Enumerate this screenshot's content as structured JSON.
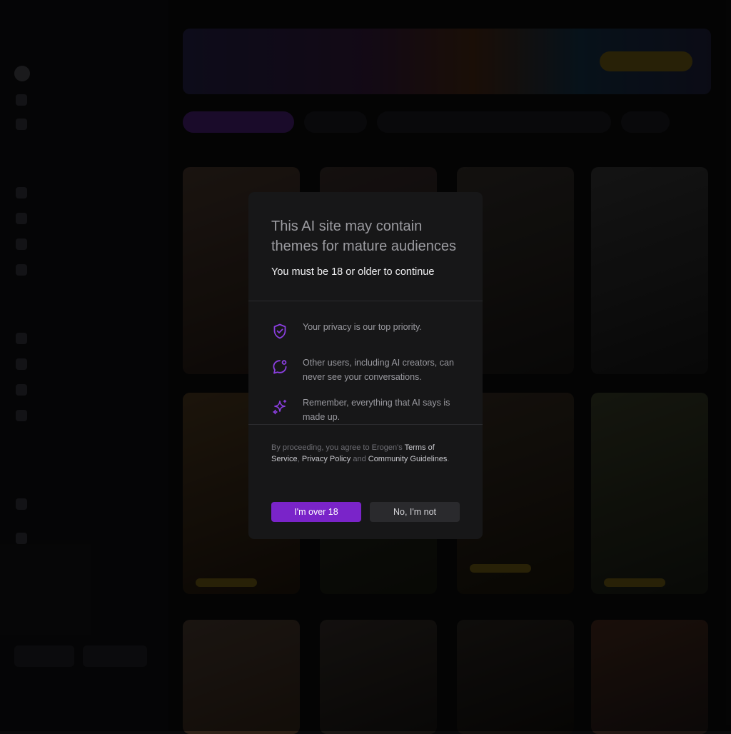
{
  "modal": {
    "title": "This AI site may contain themes for mature audiences",
    "subtitle": "You must be 18 or older to continue",
    "features": [
      {
        "icon": "shield-check-icon",
        "text": "Your privacy is our top priority."
      },
      {
        "icon": "chat-bubble-icon",
        "text": "Other users, including AI creators, can never see your conversations."
      },
      {
        "icon": "sparkles-icon",
        "text": "Remember, everything that AI says is made up."
      }
    ],
    "consent_prefix": "By proceeding, you agree to Erogen's ",
    "terms_label": "Terms of Service",
    "sep_comma": ", ",
    "privacy_label": "Privacy Policy",
    "sep_and": " and ",
    "guidelines_label": "Community Guidelines",
    "consent_suffix": ".",
    "confirm_label": "I'm over 18",
    "decline_label": "No, I'm not"
  },
  "colors": {
    "accent": "#7a24c9",
    "modal_bg": "#171718",
    "icon": "#8b3fe0"
  }
}
